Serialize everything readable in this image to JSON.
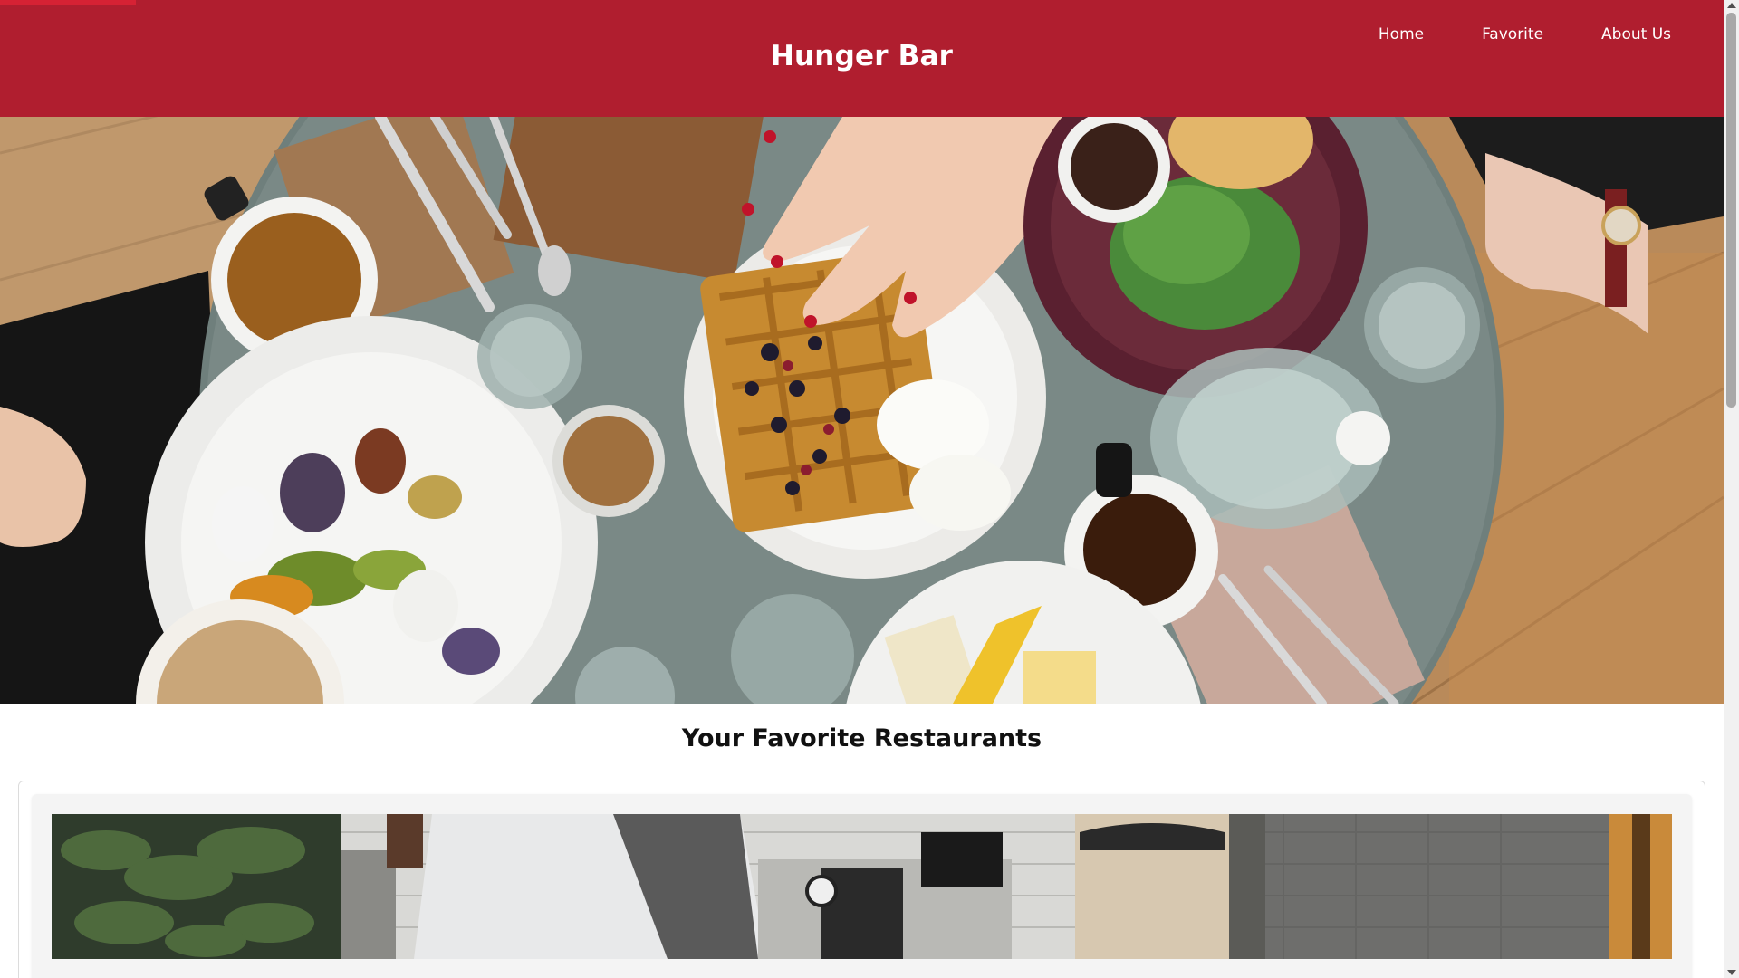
{
  "header": {
    "brand": "Hunger Bar",
    "nav": [
      {
        "label": "Home"
      },
      {
        "label": "Favorite"
      },
      {
        "label": "About Us"
      }
    ]
  },
  "main": {
    "section_title": "Your Favorite Restaurants"
  },
  "colors": {
    "brand_red": "#b01e2f",
    "accent_red": "#d62234",
    "text_dark": "#111111"
  },
  "icons": {
    "scroll_up": "chevron-up-icon",
    "scroll_down": "chevron-down-icon"
  }
}
